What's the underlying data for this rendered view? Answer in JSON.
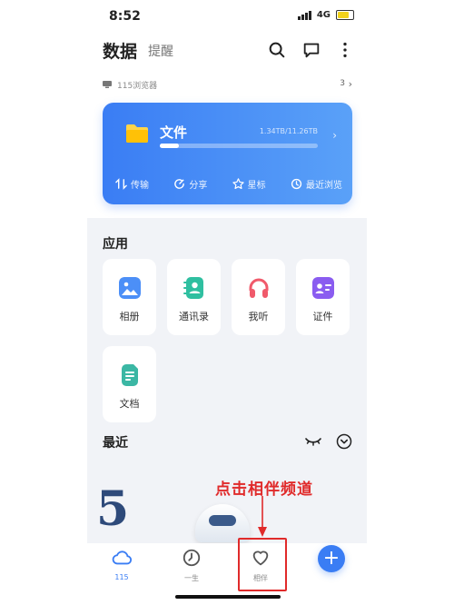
{
  "status_bar": {
    "time": "8:52",
    "network": "4G"
  },
  "header": {
    "title": "数据",
    "tab_secondary": "提醒",
    "icons": [
      "search-icon",
      "message-icon",
      "more-vertical-icon"
    ]
  },
  "device": {
    "label": "115浏览器",
    "count": "3"
  },
  "files_card": {
    "title": "文件",
    "storage": "1.34TB/11.26TB",
    "usage_fraction": 0.12,
    "actions": [
      "传输",
      "分享",
      "星标",
      "最近浏览"
    ]
  },
  "apps": {
    "title": "应用",
    "items": [
      "相册",
      "通讯录",
      "我听",
      "证件",
      "文档"
    ]
  },
  "recent": {
    "title": "最近",
    "banner_text": "5"
  },
  "annotation": {
    "text": "点击相伴频道"
  },
  "bottom_nav": {
    "items": [
      "115",
      "一生",
      "相伴"
    ],
    "fab": "+"
  },
  "colors": {
    "accent": "#3a7df4",
    "annotation": "#e02a2a",
    "panel": "#f1f3f7"
  }
}
